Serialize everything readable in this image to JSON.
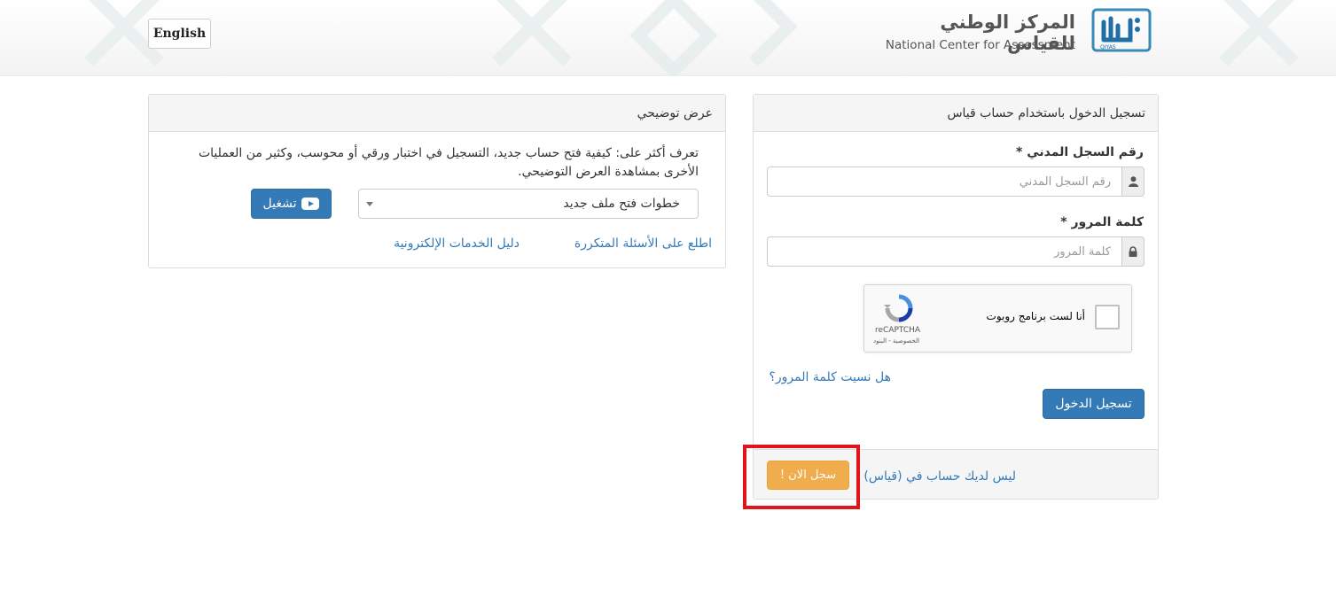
{
  "header": {
    "language_button": "English",
    "logo_ar": "المركز الوطني للقياس",
    "logo_en": "National Center for Assessment",
    "logo_icon": "qiyas-logo-icon",
    "logo_icon_caption": "QIYAS"
  },
  "login": {
    "title": "تسجيل الدخول باستخدام حساب قياس",
    "id_label": "رقم السجل المدني *",
    "id_placeholder": "رقم السجل المدني",
    "id_icon": "user-icon",
    "password_label": "كلمة المرور *",
    "password_placeholder": "كلمة المرور",
    "password_icon": "lock-icon",
    "captcha_text": "أنا لست برنامج روبوت",
    "captcha_brand": "reCAPTCHA",
    "captcha_links": "الخصوصية - البنود",
    "forgot_password": "هل نسيت كلمة المرور؟",
    "login_button": "تسجيل الدخول",
    "no_account_text": "ليس لديك حساب في (قياس)",
    "register_button": "سجل الان !"
  },
  "demo": {
    "title": "عرض توضيحي",
    "description": "تعرف أكثر على: كيفية فتح حساب جديد، التسجيل في اختبار ورقي أو محوسب، وكثير من العمليات الأخرى بمشاهدة العرض التوضيحي.",
    "select_value": "خطوات فتح ملف جديد",
    "play_button": "تشغيل",
    "faq_link": "اطلع على الأسئلة المتكررة",
    "services_guide_link": "دليل الخدمات الإلكترونية"
  },
  "colors": {
    "primary": "#337ab7",
    "warning": "#f0ad4e",
    "highlight": "#e0151c"
  }
}
